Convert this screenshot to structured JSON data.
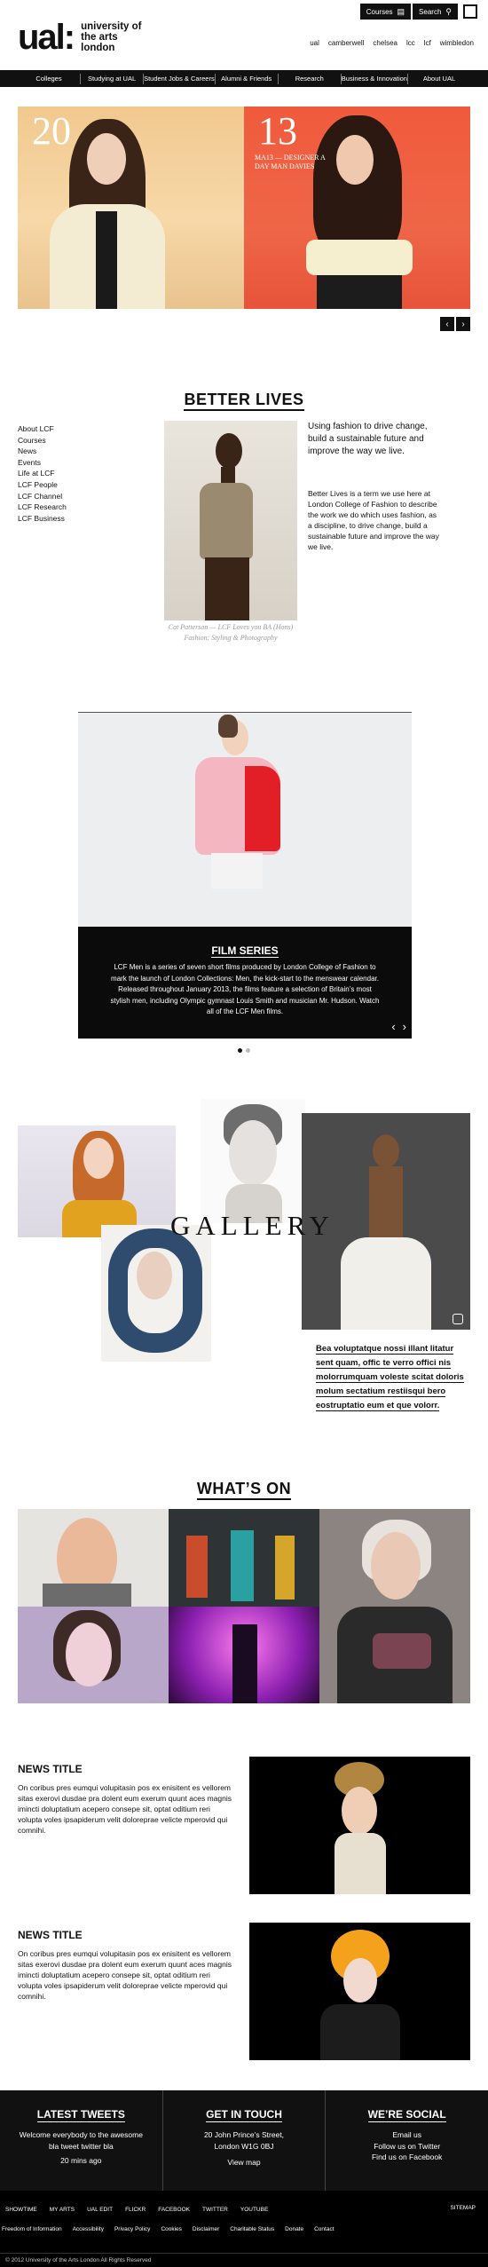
{
  "brand": {
    "mark": "ual:",
    "name": "university of the arts london"
  },
  "utility": {
    "courses": "Courses",
    "search": "Search"
  },
  "colleges": [
    "ual",
    "camberwell",
    "chelsea",
    "lcc",
    "lcf",
    "wimbledon"
  ],
  "nav": [
    "Colleges",
    "Studying at UAL",
    "Student Jobs & Careers",
    "Alumni & Friends",
    "Research",
    "Business & Innovation",
    "About UAL"
  ],
  "hero": {
    "year_left": "20",
    "year_right": "13",
    "caption": "MA13 — DESIGNER A DAY MAN DAVIES"
  },
  "better_lives": {
    "title": "BETTER LIVES",
    "sidebar": [
      "About LCF",
      "Courses",
      "News",
      "Events",
      "Life at LCF",
      "LCF People",
      "LCF Channel",
      "LCF Research",
      "LCF Business"
    ],
    "caption": "Cat Patterson — LCF Loves you BA (Hons) Fashion: Styling & Photography",
    "lead": "Using fashion to drive change, build a sustainable future and improve the way we live.",
    "body": "Better Lives is a term we use here at London College of Fashion to describe the work we do which uses fashion, as a discipline, to drive change, build a sustainable future and improve the way we live."
  },
  "film": {
    "title": "FILM SERIES",
    "body": "LCF Men is a series of seven short films produced by London College of Fashion to mark the launch of London Collections: Men, the kick-start to the menswear calendar. Released throughout January 2013, the films feature a selection of Britain’s most stylish men, including Olympic gymnast Louis Smith and musician Mr. Hudson. Watch all of the LCF Men films."
  },
  "gallery": {
    "word": "GALLERY",
    "quote": "Bea voluptatque nossi illant litatur sent quam, offic te verro offici nis molorrumquam voleste scitat doloris molum sectatium restiisqui bero eostruptatio eum et que volorr."
  },
  "whats_on": {
    "title": "WHAT’S ON"
  },
  "news": [
    {
      "title": "NEWS TITLE",
      "body": "On coribus pres eumqui volupitasin pos ex enisitent es vellorem sitas exerovi dusdae pra dolent eum exerum quunt aces magnis imincti doluptatium acepero consepe sit, optat oditium reri volupta voles ipsapiderum velit doloreprae velicte mperovid qui comnihi."
    },
    {
      "title": "NEWS TITLE",
      "body": "On coribus pres eumqui volupitasin pos ex enisitent es vellorem sitas exerovi dusdae pra dolent eum exerum quunt aces magnis imincti doluptatium acepero consepe sit, optat oditium reri volupta voles ipsapiderum velit doloreprae velicte mperovid qui comnihi."
    }
  ],
  "footer": {
    "tweets": {
      "title": "LATEST TWEETS",
      "text": "Welcome everybody to the awesome bla tweet twitter bla",
      "time": "20 mins ago"
    },
    "contact": {
      "title": "GET IN TOUCH",
      "address": "20 John Prince’s Street, London W1G 0BJ",
      "map": "View map"
    },
    "social": {
      "title": "WE’RE SOCIAL",
      "items": [
        "Email us",
        "Follow us on Twitter",
        "Find us on Facebook"
      ]
    },
    "links1": [
      "SHOWTIME",
      "MY ARTS",
      "UAL EDIT",
      "FLICKR",
      "FACEBOOK",
      "TWITTER",
      "YOUTUBE"
    ],
    "sitemap": "SITEMAP",
    "links2": [
      "Freedom of Information",
      "Accessibility",
      "Privacy Policy",
      "Cookies",
      "Disclaimer",
      "Charitable Status",
      "Donate",
      "Contact"
    ],
    "copyright": "© 2012 University of the Arts London All Rights Reserved"
  },
  "colors": {
    "accent": "#111111",
    "hero_left": "#f1c98f",
    "hero_right": "#f05a3c"
  }
}
